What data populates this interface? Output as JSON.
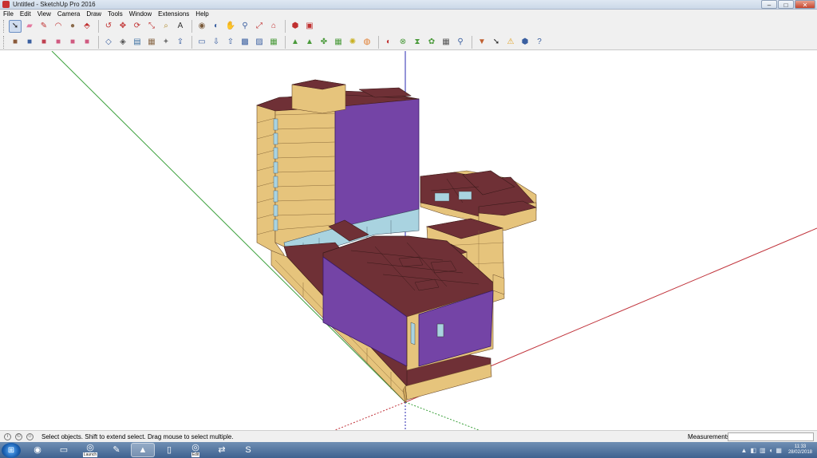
{
  "window": {
    "title": "Untitled - SketchUp Pro 2016",
    "buttons": [
      "minimize-button",
      "maximize-button",
      "close-button"
    ]
  },
  "menu": [
    "File",
    "Edit",
    "View",
    "Camera",
    "Draw",
    "Tools",
    "Window",
    "Extensions",
    "Help"
  ],
  "toolbar1": [
    {
      "name": "select-tool",
      "glyph": "➘",
      "color": "#222",
      "selected": true
    },
    {
      "name": "eraser-tool",
      "glyph": "▰",
      "color": "#e47aa0"
    },
    {
      "name": "pencil-line-tool",
      "glyph": "✎",
      "color": "#c03030"
    },
    {
      "name": "arc-tool",
      "glyph": "◠",
      "color": "#c03030"
    },
    {
      "name": "circle-shape-tool",
      "glyph": "●",
      "color": "#8a6a4a"
    },
    {
      "name": "push-pull-tool",
      "glyph": "⬘",
      "color": "#c03030"
    },
    {
      "name": "offset-tool",
      "glyph": "↺",
      "color": "#c03030"
    },
    {
      "name": "move-tool",
      "glyph": "✥",
      "color": "#c03030"
    },
    {
      "name": "rotate-tool",
      "glyph": "⟳",
      "color": "#c03030"
    },
    {
      "name": "scale-tool",
      "glyph": "⤡",
      "color": "#c03030"
    },
    {
      "name": "tape-measure-tool",
      "glyph": "⌕",
      "color": "#b08a2a"
    },
    {
      "name": "text-tool",
      "glyph": "A",
      "color": "#333"
    },
    {
      "name": "paint-bucket-tool",
      "glyph": "◉",
      "color": "#7a5a3a"
    },
    {
      "name": "orbit-tool",
      "glyph": "◐",
      "color": "#3a5fa0"
    },
    {
      "name": "pan-tool",
      "glyph": "✋",
      "color": "#c8a050"
    },
    {
      "name": "zoom-tool",
      "glyph": "⚲",
      "color": "#3a5fa0"
    },
    {
      "name": "zoom-extents-tool",
      "glyph": "⤢",
      "color": "#c03030"
    },
    {
      "name": "warehouse-tool",
      "glyph": "⌂",
      "color": "#c03030"
    },
    {
      "name": "extension-warehouse-tool",
      "glyph": "⬢",
      "color": "#c03030"
    },
    {
      "name": "layout-tool",
      "glyph": "▣",
      "color": "#c03030"
    }
  ],
  "toolbar2": [
    {
      "name": "default-style-tool",
      "glyph": "■",
      "color": "#8a5a3a"
    },
    {
      "name": "iso-view-tool",
      "glyph": "■",
      "color": "#3a5fa0"
    },
    {
      "name": "top-view-tool",
      "glyph": "■",
      "color": "#c04050"
    },
    {
      "name": "front-view-tool",
      "glyph": "■",
      "color": "#d05a80"
    },
    {
      "name": "right-view-tool",
      "glyph": "■",
      "color": "#d05a80"
    },
    {
      "name": "back-view-tool",
      "glyph": "■",
      "color": "#d05a80"
    },
    {
      "name": "xray-tool",
      "glyph": "◇",
      "color": "#3a5fa0"
    },
    {
      "name": "wireframe-tool",
      "glyph": "◈",
      "color": "#555"
    },
    {
      "name": "hidden-line-tool",
      "glyph": "▤",
      "color": "#3a6fa0"
    },
    {
      "name": "shaded-tool",
      "glyph": "▦",
      "color": "#8a6a4a"
    },
    {
      "name": "new-space-tool",
      "glyph": "✦",
      "color": "#777"
    },
    {
      "name": "open-tool",
      "glyph": "⇪",
      "color": "#3a5fa0"
    },
    {
      "name": "save-tool",
      "glyph": "▭",
      "color": "#3a5fa0"
    },
    {
      "name": "import-tool",
      "glyph": "⇩",
      "color": "#3a5fa0"
    },
    {
      "name": "export-tool",
      "glyph": "⇧",
      "color": "#3a5fa0"
    },
    {
      "name": "idf-tool",
      "glyph": "▩",
      "color": "#3a5fa0"
    },
    {
      "name": "gbxml-tool",
      "glyph": "▨",
      "color": "#3a5fa0"
    },
    {
      "name": "thermal-zone-tool",
      "glyph": "▦",
      "color": "#4a9a3a"
    },
    {
      "name": "surface-matching-tool",
      "glyph": "▲",
      "color": "#4a9a3a"
    },
    {
      "name": "space-type-tool",
      "glyph": "▲",
      "color": "#4a9a3a"
    },
    {
      "name": "loads-tool",
      "glyph": "✤",
      "color": "#4a9a3a"
    },
    {
      "name": "constructions-tool",
      "glyph": "▦",
      "color": "#4a9a3a"
    },
    {
      "name": "lighting-tool",
      "glyph": "✺",
      "color": "#c8b020"
    },
    {
      "name": "people-tool",
      "glyph": "◍",
      "color": "#e07a2a"
    },
    {
      "name": "equipment-tool",
      "glyph": "◐",
      "color": "#c03030"
    },
    {
      "name": "hvac-tool",
      "glyph": "⊗",
      "color": "#4a9a3a"
    },
    {
      "name": "schedules-tool",
      "glyph": "⧗",
      "color": "#4a9a3a"
    },
    {
      "name": "daylight-tool",
      "glyph": "✿",
      "color": "#4a9a3a"
    },
    {
      "name": "grid-tool",
      "glyph": "▦",
      "color": "#555"
    },
    {
      "name": "inspector-tool",
      "glyph": "⚲",
      "color": "#3a5fa0"
    },
    {
      "name": "filter-tool",
      "glyph": "▼",
      "color": "#c06030"
    },
    {
      "name": "select-all-tool",
      "glyph": "➘",
      "color": "#222"
    },
    {
      "name": "warning-tool",
      "glyph": "⚠",
      "color": "#e0a020"
    },
    {
      "name": "info-tool",
      "glyph": "⬢",
      "color": "#3a5fa0"
    },
    {
      "name": "help-tool",
      "glyph": "?",
      "color": "#3a5fa0"
    }
  ],
  "colors": {
    "floor": "#6f3036",
    "wall": "#e6c47c",
    "wall_shade": "#c8a25a",
    "exterior_wall": "#7444a6",
    "exterior_wall_dark": "#5a3488",
    "window": "#a9d3e0",
    "axis_red": "#c0323a",
    "axis_green": "#3aa03a",
    "axis_blue": "#2a2ab0"
  },
  "status": {
    "text": "Select objects. Shift to extend select. Drag mouse to select multiple.",
    "measurements_label": "Measurements"
  },
  "taskbar": {
    "apps": [
      {
        "name": "chrome-taskbar-button",
        "glyph": "◉",
        "label": ""
      },
      {
        "name": "explorer-taskbar-button",
        "glyph": "▭",
        "label": ""
      },
      {
        "name": "launch-taskbar-button",
        "glyph": "◎",
        "label": "Launch"
      },
      {
        "name": "pen-taskbar-button",
        "glyph": "✎",
        "label": ""
      },
      {
        "name": "sketchup-taskbar-button",
        "glyph": "▲",
        "label": "",
        "active": true
      },
      {
        "name": "document-taskbar-button",
        "glyph": "▯",
        "label": ""
      },
      {
        "name": "edit-taskbar-button",
        "glyph": "◎",
        "label": "Edit"
      },
      {
        "name": "switch-taskbar-button",
        "glyph": "⇄",
        "label": ""
      },
      {
        "name": "skype-taskbar-button",
        "glyph": "S",
        "label": ""
      }
    ],
    "time": "11:33",
    "date": "28/02/2018"
  }
}
